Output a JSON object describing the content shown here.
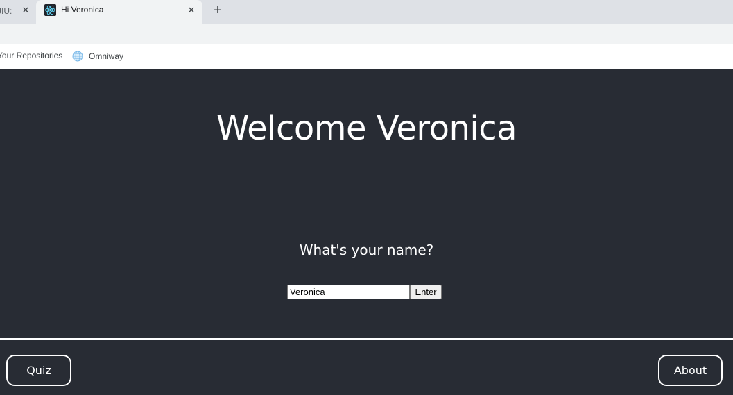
{
  "browser": {
    "tabs": [
      {
        "title": "JIU:",
        "active": false
      },
      {
        "title": "Hi Veronica",
        "active": true
      }
    ],
    "new_tab_symbol": "+",
    "close_symbol": "✕",
    "bookmarks": [
      {
        "label": "Your Repositories"
      },
      {
        "label": "Omniway",
        "icon": "globe-icon"
      }
    ]
  },
  "page": {
    "heading": "Welcome Veronica",
    "question": "What's your name?",
    "name_input": {
      "value": "Veronica",
      "placeholder": ""
    },
    "enter_label": "Enter",
    "footer": {
      "quiz_label": "Quiz",
      "about_label": "About"
    }
  },
  "colors": {
    "background": "#282c34",
    "text": "#ffffff",
    "divider": "#ffffff"
  }
}
